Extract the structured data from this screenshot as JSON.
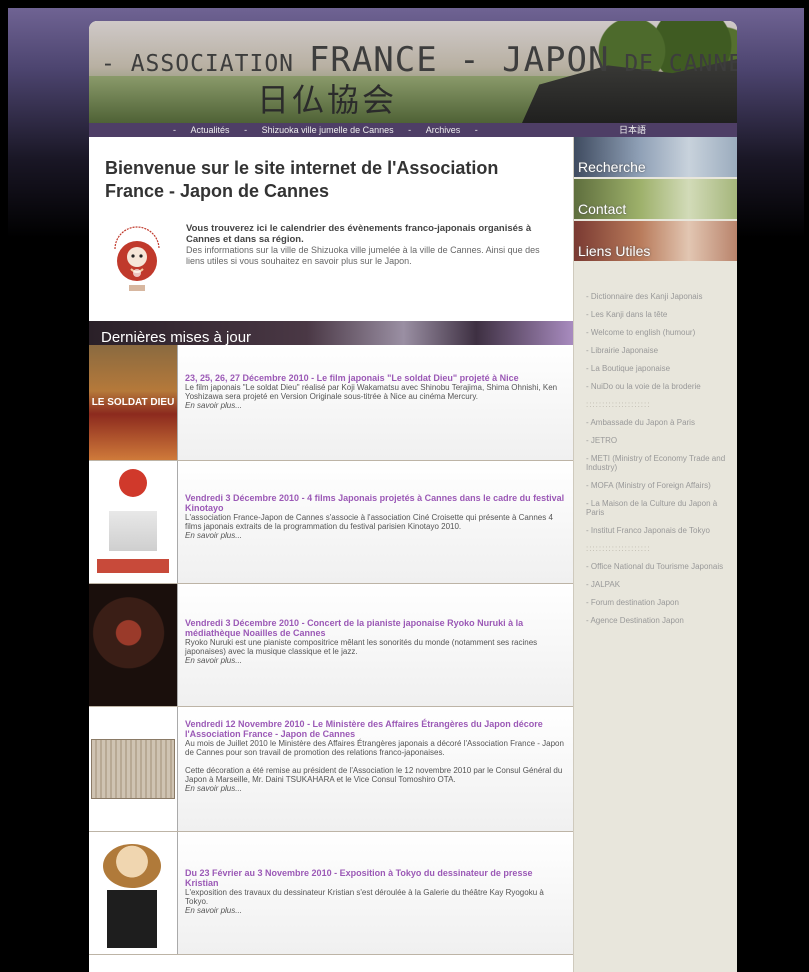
{
  "header": {
    "assoc_prefix": "- ASSOCIATION",
    "assoc_main": "FRANCE - JAPON",
    "assoc_suffix": "DE CANNES -",
    "kanji": "日仏協会"
  },
  "nav": {
    "items": [
      "-",
      "Actualités",
      "-",
      "Shizuoka ville jumelle de Cannes",
      "-",
      "Archives",
      "-"
    ],
    "japanese": "日本語"
  },
  "welcome": {
    "title": "Bienvenue sur le site internet de l'Association France - Japon de Cannes",
    "intro_strong": "Vous trouverez ici le calendrier des évènements franco-japonais organisés à Cannes et dans sa région.",
    "intro_text": "Des informations sur la ville de Shizuoka ville jumelée à la ville de Cannes. Ainsi que des liens utiles si vous souhaitez en savoir plus sur le Japon."
  },
  "section": {
    "title": "Dernières mises à jour"
  },
  "news": [
    {
      "title": "23, 25, 26, 27 Décembre 2010 - Le film japonais \"Le soldat Dieu\" projeté à Nice",
      "text": "Le film japonais \"Le soldat Dieu\" réalisé par Koji Wakamatsu avec Shinobu Terajima, Shima Ohnishi, Ken Yoshizawa sera projeté en Version Originale sous-titrée à Nice au cinéma Mercury.",
      "more": "En savoir plus...",
      "thumb_text": "LE SOLDAT DIEU"
    },
    {
      "title": "Vendredi 3 Décembre 2010 - 4 films Japonais projetés à Cannes dans le cadre du festival Kinotayo",
      "text": "L'association France-Japon de Cannes s'associe à l'association Ciné Croisette qui présente à Cannes 4 films japonais extraits de la programmation du festival parisien Kinotayo 2010.",
      "more": "En savoir plus..."
    },
    {
      "title": "Vendredi 3 Décembre 2010 - Concert de la pianiste japonaise Ryoko Nuruki à la médiathèque Noailles de Cannes",
      "text": "Ryoko Nuruki est une pianiste compositrice mêlant les sonorités du monde (notamment ses racines japonaises) avec la musique classique et le jazz.",
      "more": "En savoir plus..."
    },
    {
      "title": "Vendredi 12 Novembre 2010 - Le Ministère des Affaires Étrangères du Japon décore l'Association France - Japon de Cannes",
      "text": "Au mois de Juillet 2010 le Ministère des Affaires Étrangères japonais a décoré l'Association France - Japon de Cannes pour son travail de promotion des relations franco-japonaises.",
      "text2": "Cette décoration a été remise au président de l'Association le 12 novembre 2010 par le Consul Général du Japon à Marseille, Mr. Daini TSUKAHARA et le Vice Consul Tomoshiro OTA.",
      "more": "En savoir plus..."
    },
    {
      "title": "Du 23 Février au 3 Novembre 2010 - Exposition à Tokyo du dessinateur de presse Kristian",
      "text": "L'exposition des travaux du dessinateur Kristian s'est déroulée à la Galerie du théâtre Kay Ryogoku à Tokyo.",
      "more": "En savoir plus..."
    }
  ],
  "sidebar": {
    "buttons": [
      "Recherche",
      "Contact",
      "Liens Utiles"
    ],
    "links": [
      "- Dictionnaire des Kanji Japonais",
      "- Les Kanji dans la tête",
      "- Welcome to english (humour)",
      "- Librairie Japonaise",
      "- La Boutique japonaise",
      "- NuiDo ou la voie de la broderie",
      "::::::::::::::::::::",
      "- Ambassade du Japon à Paris",
      "- JETRO",
      "- METI (Ministry of Economy Trade and Industry)",
      "- MOFA (Ministry of Foreign Affairs)",
      "- La Maison de la Culture du Japon à Paris",
      "- Institut Franco Japonais de Tokyo",
      "::::::::::::::::::::",
      "- Office National du Tourisme Japonais",
      "- JALPAK",
      "- Forum destination Japon",
      "- Agence Destination Japon"
    ]
  }
}
